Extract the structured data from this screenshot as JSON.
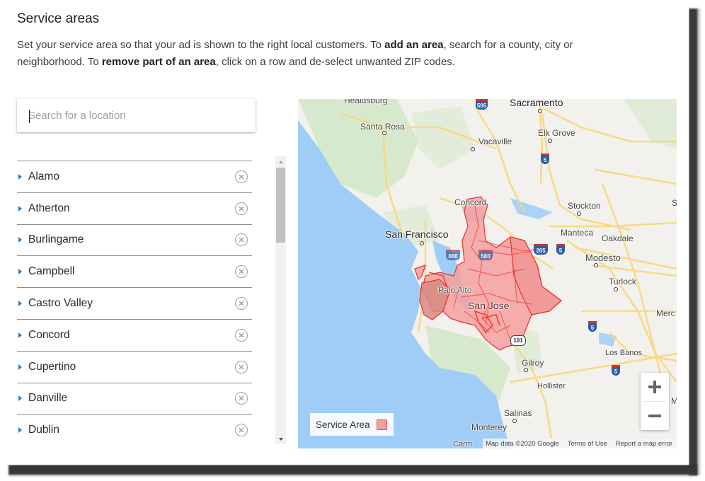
{
  "header": {
    "title": "Service areas",
    "desc_part1": "Set your service area so that your ad is shown to the right local customers. To ",
    "desc_bold1": "add an area",
    "desc_part2": ", search for a county, city or neighborhood. To ",
    "desc_bold2": "remove part of an area",
    "desc_part3": ", click on a row and de-select unwanted ZIP codes."
  },
  "search": {
    "placeholder": "Search for a location",
    "value": ""
  },
  "areas": [
    {
      "name": "Alamo"
    },
    {
      "name": "Atherton"
    },
    {
      "name": "Burlingame"
    },
    {
      "name": "Campbell"
    },
    {
      "name": "Castro Valley"
    },
    {
      "name": "Concord"
    },
    {
      "name": "Cupertino"
    },
    {
      "name": "Danville"
    },
    {
      "name": "Dublin"
    }
  ],
  "map": {
    "labels": {
      "healdsburg": "Healdsburg",
      "santa_rosa": "Santa Rosa",
      "sacramento": "Sacramento",
      "elk_grove": "Elk Grove",
      "vacaville": "Vacaville",
      "concord": "Concord",
      "stockton": "Stockton",
      "san_francisco": "San Francisco",
      "manteca": "Manteca",
      "oakdale": "Oakdale",
      "modesto": "Modesto",
      "turlock": "Turlock",
      "palo_alto": "Palo Alto",
      "san_jose": "San Jose",
      "merced": "Merc",
      "los_banos": "Los Banos",
      "gilroy": "Gilroy",
      "hollister": "Hollister",
      "salinas": "Salinas",
      "monterey": "Monterey",
      "carmel": "Carm",
      "s_edge": "S",
      "m_edge": "M"
    },
    "shields": {
      "i505": "505",
      "i5a": "5",
      "i205": "205",
      "i5b": "5",
      "i5c": "5",
      "i5d": "5",
      "i880": "880",
      "i580": "580",
      "us101": "101"
    },
    "legend_label": "Service Area",
    "zoom_in": "+",
    "zoom_out": "−",
    "attribution": "Map data ©2020 Google",
    "terms": "Terms of Use",
    "report": "Report a map error",
    "colors": {
      "service_fill": "#f4a0a0",
      "service_stroke": "#e8322c",
      "water": "#9fcdf7",
      "land": "#f2f1ee",
      "park": "#cfe7c4",
      "road": "#fbd36b"
    }
  }
}
